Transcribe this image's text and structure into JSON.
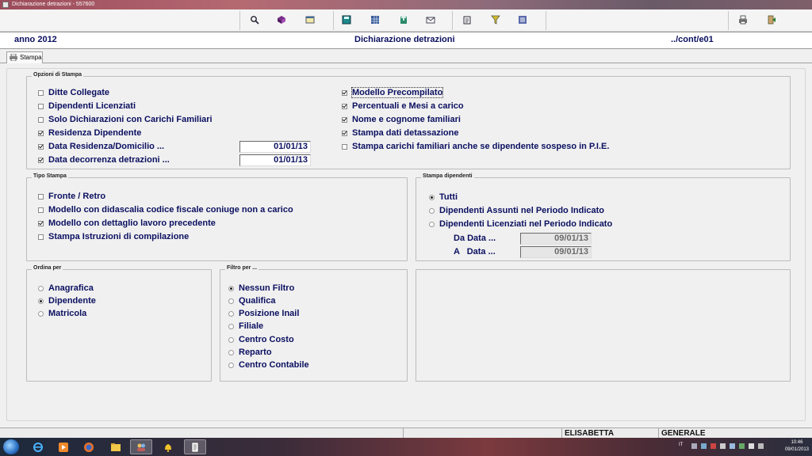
{
  "window": {
    "title": "Dichiarazione detrazioni - 557600"
  },
  "header": {
    "year_label": "anno 2012",
    "title": "Dichiarazione detrazioni",
    "path": "../cont/e01"
  },
  "tabs": [
    {
      "label": "Stampa",
      "icon": "printer-icon"
    }
  ],
  "toolbar_icons": [
    "search-icon",
    "cube-icon",
    "window-icon",
    "save-icon",
    "grid-icon",
    "export-icon",
    "mail-icon",
    "clipboard-icon",
    "filter-icon",
    "list-icon",
    "print-icon",
    "exit-icon"
  ],
  "opzioni_stampa": {
    "title": "Opzioni di Stampa",
    "left": [
      {
        "label": "Ditte Collegate",
        "checked": false
      },
      {
        "label": "Dipendenti Licenziati",
        "checked": false
      },
      {
        "label": "Solo Dichiarazioni con Carichi Familiari",
        "checked": false
      },
      {
        "label": "Residenza Dipendente",
        "checked": true
      },
      {
        "label": "Data Residenza/Domicilio ...",
        "checked": true,
        "date": "01/01/13"
      },
      {
        "label": "Data decorrenza detrazioni ...",
        "checked": true,
        "date": "01/01/13"
      }
    ],
    "right": [
      {
        "label": "Modello Precompilato",
        "checked": true
      },
      {
        "label": "Percentuali e Mesi a carico",
        "checked": true
      },
      {
        "label": "Nome e cognome familiari",
        "checked": true
      },
      {
        "label": "Stampa dati detassazione",
        "checked": true
      },
      {
        "label": "Stampa carichi familiari anche se dipendente sospeso in P.I.E.",
        "checked": false
      }
    ]
  },
  "tipo_stampa": {
    "title": "Tipo Stampa",
    "items": [
      {
        "label": "Fronte / Retro",
        "checked": false
      },
      {
        "label": "Modello con didascalia codice fiscale coniuge non a carico",
        "checked": false
      },
      {
        "label": "Modello con dettaglio lavoro precedente",
        "checked": true
      },
      {
        "label": "Stampa Istruzioni di compilazione",
        "checked": false
      }
    ]
  },
  "stampa_dipendenti": {
    "title": "Stampa dipendenti",
    "items": [
      {
        "label": "Tutti",
        "selected": true
      },
      {
        "label": "Dipendenti Assunti nel  Periodo Indicato",
        "selected": false
      },
      {
        "label": "Dipendenti Licenziati nel  Periodo Indicato",
        "selected": false
      }
    ],
    "da_data_label": "Da Data ...",
    "da_data_value": "09/01/13",
    "a_data_label": "A   Data ...",
    "a_data_value": "09/01/13"
  },
  "ordina_per": {
    "title": "Ordina per",
    "items": [
      {
        "label": "Anagrafica",
        "selected": false
      },
      {
        "label": "Dipendente",
        "selected": true
      },
      {
        "label": "Matricola",
        "selected": false
      }
    ]
  },
  "filtro_per": {
    "title": "Filtro per ...",
    "items": [
      {
        "label": "Nessun Filtro",
        "selected": true
      },
      {
        "label": "Qualifica",
        "selected": false
      },
      {
        "label": "Posizione Inail",
        "selected": false
      },
      {
        "label": "Filiale",
        "selected": false
      },
      {
        "label": "Centro Costo",
        "selected": false
      },
      {
        "label": "Reparto",
        "selected": false
      },
      {
        "label": "Centro Contabile",
        "selected": false
      }
    ]
  },
  "statusbar": {
    "user": "ELISABETTA",
    "context": "GENERALE"
  },
  "taskbar": {
    "lang": "IT",
    "time": "10:46",
    "date": "09/01/2013"
  }
}
